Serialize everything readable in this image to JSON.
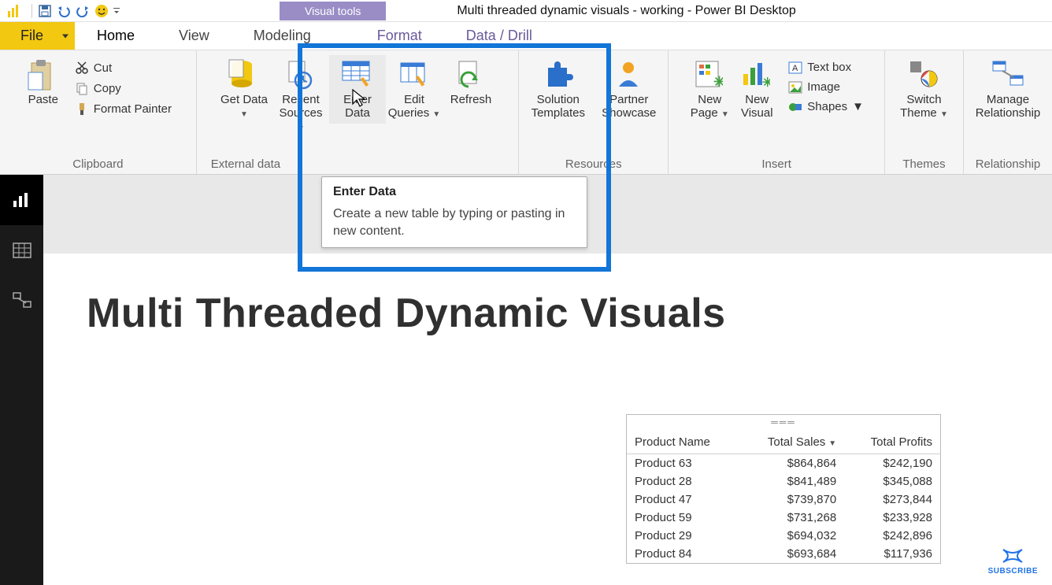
{
  "title": "Multi threaded dynamic visuals - working - Power BI Desktop",
  "context_tab": "Visual tools",
  "tabs": {
    "file": "File",
    "home": "Home",
    "view": "View",
    "modeling": "Modeling",
    "format": "Format",
    "datadrill": "Data / Drill"
  },
  "clipboard": {
    "paste": "Paste",
    "cut": "Cut",
    "copy": "Copy",
    "format_painter": "Format Painter",
    "group": "Clipboard"
  },
  "external": {
    "get_data": "Get Data",
    "recent_sources": "Recent Sources",
    "enter_data": "Enter Data",
    "edit_queries": "Edit Queries",
    "refresh": "Refresh",
    "group": "External data"
  },
  "resources": {
    "solution_templates": "Solution Templates",
    "partner_showcase": "Partner Showcase",
    "group": "Resources"
  },
  "insert": {
    "new_page": "New Page",
    "new_visual": "New Visual",
    "text_box": "Text box",
    "image": "Image",
    "shapes": "Shapes",
    "group": "Insert"
  },
  "themes": {
    "switch_theme": "Switch Theme",
    "group": "Themes"
  },
  "relationships": {
    "manage": "Manage Relationship",
    "group": "Relationship"
  },
  "tooltip": {
    "title": "Enter Data",
    "body": "Create a new table by typing or pasting in new content."
  },
  "page_heading": "Multi Threaded Dynamic Visuals",
  "table": {
    "headers": {
      "name": "Product Name",
      "sales": "Total Sales",
      "profits": "Total Profits"
    },
    "rows": [
      {
        "name": "Product 63",
        "sales": "$864,864",
        "profits": "$242,190"
      },
      {
        "name": "Product 28",
        "sales": "$841,489",
        "profits": "$345,088"
      },
      {
        "name": "Product 47",
        "sales": "$739,870",
        "profits": "$273,844"
      },
      {
        "name": "Product 59",
        "sales": "$731,268",
        "profits": "$233,928"
      },
      {
        "name": "Product 29",
        "sales": "$694,032",
        "profits": "$242,896"
      },
      {
        "name": "Product 84",
        "sales": "$693,684",
        "profits": "$117,936"
      }
    ]
  },
  "subscribe": "SUBSCRIBE"
}
